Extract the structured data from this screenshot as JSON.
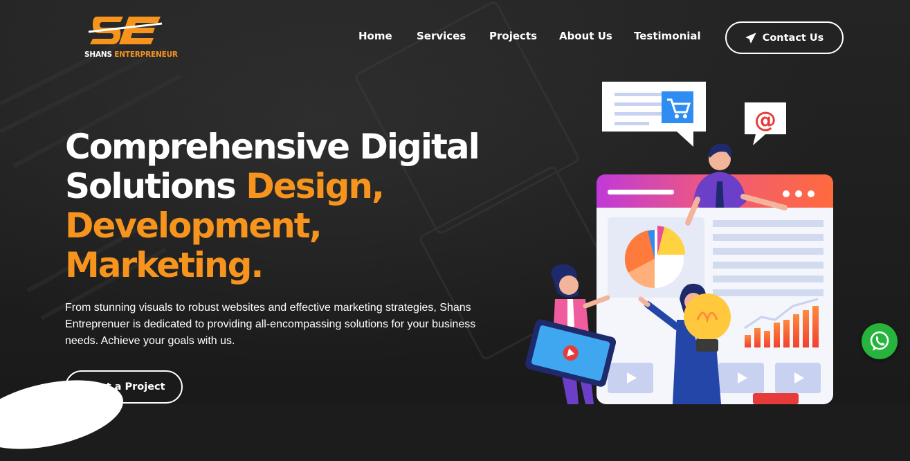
{
  "brand": {
    "logo_icon": "se-logo-mark",
    "name_part1": "SHANS",
    "name_part2": "ENTERPRENEUR"
  },
  "nav": {
    "items": [
      {
        "label": "Home"
      },
      {
        "label": "Services"
      },
      {
        "label": "Projects"
      },
      {
        "label": "About Us"
      },
      {
        "label": "Testimonial"
      }
    ],
    "contact_label": "Contact Us",
    "contact_icon": "paper-plane-icon"
  },
  "hero": {
    "title_line1": "Comprehensive Digital",
    "title_line2_white": "Solutions ",
    "title_line2_accent": "Design,",
    "title_line3": "Development,",
    "title_line4": "Marketing.",
    "description": "From stunning visuals to robust websites and effective marketing strategies, Shans Entreprenuer is dedicated to providing all-encompassing solutions for your business needs. Achieve your goals with us.",
    "cta_label": "Start a Project"
  },
  "illustration": {
    "email_bubble_text": "@",
    "icons": [
      "cart-icon",
      "email-at-icon",
      "pie-chart-icon",
      "bar-chart-icon",
      "light-bulb-icon",
      "play-icon"
    ]
  },
  "floating": {
    "whatsapp_icon": "whatsapp-icon"
  },
  "colors": {
    "accent": "#f7941d",
    "background": "#1c1c1c",
    "whatsapp": "#26b43c"
  }
}
